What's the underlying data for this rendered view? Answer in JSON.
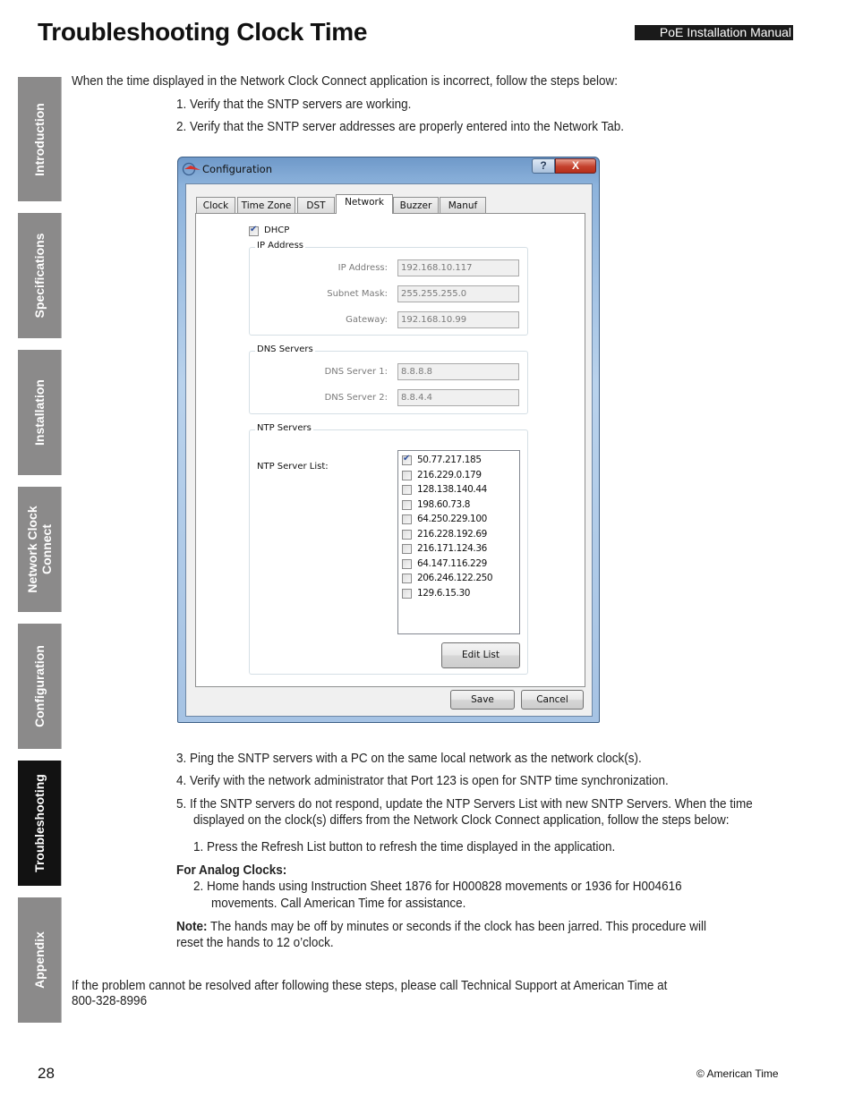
{
  "header": {
    "title": "Troubleshooting Clock Time",
    "manual_badge": "PoE Installation Manual"
  },
  "side_tabs": [
    {
      "label": "Introduction",
      "active": false
    },
    {
      "label": "Specifications",
      "active": false
    },
    {
      "label": "Installation",
      "active": false
    },
    {
      "label": "Network Clock Connect",
      "active": false
    },
    {
      "label": "Configuration",
      "active": false
    },
    {
      "label": "Troubleshooting",
      "active": true
    },
    {
      "label": "Appendix",
      "active": false
    }
  ],
  "content": {
    "intro": "When the time displayed in the Network Clock Connect application is incorrect, follow the steps below:",
    "step1": "1.  Verify that the SNTP servers are working.",
    "step2": "2.  Verify that the SNTP server addresses are properly entered into the Network Tab.",
    "step3": "3.  Ping the SNTP servers with a PC on the same local network as the network clock(s).",
    "step4": "4.  Verify with the network administrator that Port 123 is open for SNTP time synchronization.",
    "step5_line1": "5.  If the SNTP servers do not respond, update the NTP Servers List with new SNTP Servers. When the time",
    "step5_line2": "displayed on the clock(s) differs from the Network Clock Connect application, follow the steps below:",
    "sub1": "1.  Press the Refresh List button to refresh the time displayed in the application.",
    "analog_heading": "For Analog Clocks:",
    "sub2_line1": "2.  Home hands using Instruction Sheet 1876 for H000828 movements or 1936 for H004616",
    "sub2_line2": "movements. Call American Time for assistance.",
    "note_label": "Note:",
    "note_line1": " The hands may be off by minutes or seconds if the clock has been jarred. This procedure will",
    "note_line2": "reset the hands to 12 o’clock.",
    "support_line1": "If the problem cannot be resolved after following these steps, please call Technical Support at American Time at",
    "support_line2": "800-328-8996"
  },
  "dialog": {
    "title": "Configuration",
    "help_label": "?",
    "close_label": "X",
    "tabs": [
      "Clock",
      "Time Zone",
      "DST",
      "Network",
      "Buzzer",
      "Manuf"
    ],
    "active_tab": "Network",
    "dhcp_label": "DHCP",
    "dhcp_checked": true,
    "ip_group": {
      "title": "IP Address",
      "ip_label": "IP Address:",
      "ip_value": "192.168.10.117",
      "mask_label": "Subnet Mask:",
      "mask_value": "255.255.255.0",
      "gateway_label": "Gateway:",
      "gateway_value": "192.168.10.99"
    },
    "dns_group": {
      "title": "DNS Servers",
      "dns1_label": "DNS Server 1:",
      "dns1_value": "8.8.8.8",
      "dns2_label": "DNS Server 2:",
      "dns2_value": "8.8.4.4"
    },
    "ntp_group": {
      "title": "NTP Servers",
      "list_label": "NTP Server List:",
      "servers": [
        {
          "address": "50.77.217.185",
          "checked": true
        },
        {
          "address": "216.229.0.179",
          "checked": false
        },
        {
          "address": "128.138.140.44",
          "checked": false
        },
        {
          "address": "198.60.73.8",
          "checked": false
        },
        {
          "address": "64.250.229.100",
          "checked": false
        },
        {
          "address": "216.228.192.69",
          "checked": false
        },
        {
          "address": "216.171.124.36",
          "checked": false
        },
        {
          "address": "64.147.116.229",
          "checked": false
        },
        {
          "address": "206.246.122.250",
          "checked": false
        },
        {
          "address": "129.6.15.30",
          "checked": false
        }
      ],
      "edit_list_label": "Edit List"
    },
    "save_label": "Save",
    "cancel_label": "Cancel"
  },
  "footer": {
    "page_number": "28",
    "copyright": "© American Time"
  }
}
